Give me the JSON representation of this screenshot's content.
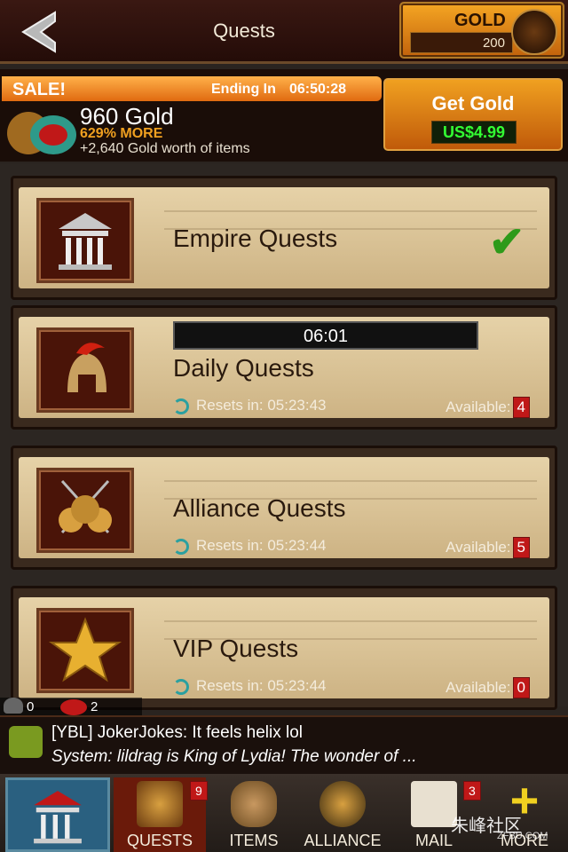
{
  "header": {
    "title": "Quests",
    "gold_label": "GOLD",
    "gold_value": "200"
  },
  "sale": {
    "tag": "SALE!",
    "ending_label": "Ending In",
    "ending_time": "06:50:28",
    "gold_amount": "960 Gold",
    "bonus": "629% MORE",
    "worth": "+2,640 Gold worth of items",
    "button_label": "Get Gold",
    "price": "US$4.99"
  },
  "quests": [
    {
      "title": "Empire Quests",
      "completed": true
    },
    {
      "title": "Daily Quests",
      "timer": "06:01",
      "resets_label": "Resets in:",
      "resets_time": "05:23:43",
      "available_label": "Available:",
      "available_count": "4"
    },
    {
      "title": "Alliance Quests",
      "resets_label": "Resets in:",
      "resets_time": "05:23:44",
      "available_label": "Available:",
      "available_count": "5"
    },
    {
      "title": "VIP Quests",
      "resets_label": "Resets in:",
      "resets_time": "05:23:44",
      "available_label": "Available:",
      "available_count": "0"
    }
  ],
  "chat": {
    "users_count": "0",
    "messages_count": "2",
    "line1": "[YBL] JokerJokes: It feels helix lol",
    "line2": "System: lildrag is King of Lydia! The wonder of ..."
  },
  "nav": {
    "quests": "QUESTS",
    "quests_badge": "9",
    "items": "ITEMS",
    "alliance": "ALLIANCE",
    "mail": "MAIL",
    "mail_badge": "3",
    "more": "MORE"
  },
  "watermark": {
    "text": "朱峰社区",
    "sub": "ZFBU.COM"
  },
  "colors": {
    "accent_orange": "#f0a020",
    "price_green": "#33ff33",
    "badge_red": "#c01818"
  }
}
